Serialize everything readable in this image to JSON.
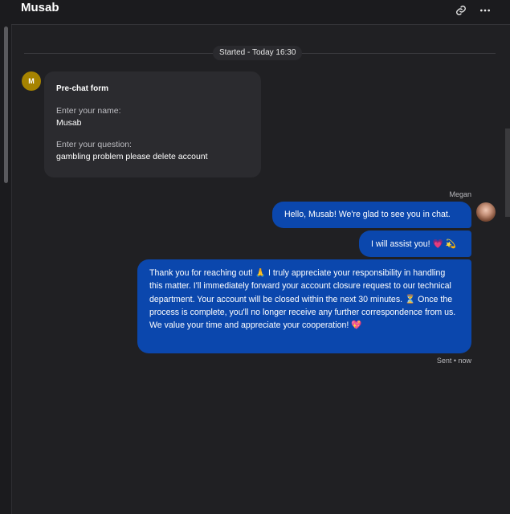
{
  "header": {
    "title": "Musab",
    "icons": [
      "link-icon",
      "more-icon"
    ]
  },
  "divider": {
    "label": "Started - Today 16:30"
  },
  "visitor": {
    "avatar_initial": "M",
    "avatar_color": "#a68300"
  },
  "prechat_form": {
    "title": "Pre-chat form",
    "fields": [
      {
        "label": "Enter your name:",
        "value": "Musab"
      },
      {
        "label": "Enter your question:",
        "value": "gambling problem please delete account"
      }
    ]
  },
  "agent": {
    "name": "Megan"
  },
  "messages": [
    "Hello, Musab! We're glad to see you in chat.",
    "I will assist you! 💗 💫",
    "Thank you for reaching out! 🙏 I truly appreciate your responsibility in handling this matter. I'll immediately forward your account closure request to our technical department. Your account will be closed within the next 30 minutes. ⏳ Once the process is complete, you'll no longer receive any further correspondence from us. We value your time and appreciate your cooperation! 💖"
  ],
  "status": "Sent • now",
  "colors": {
    "bubble": "#0b47ad",
    "background": "#202023",
    "card": "#2b2b2f"
  }
}
